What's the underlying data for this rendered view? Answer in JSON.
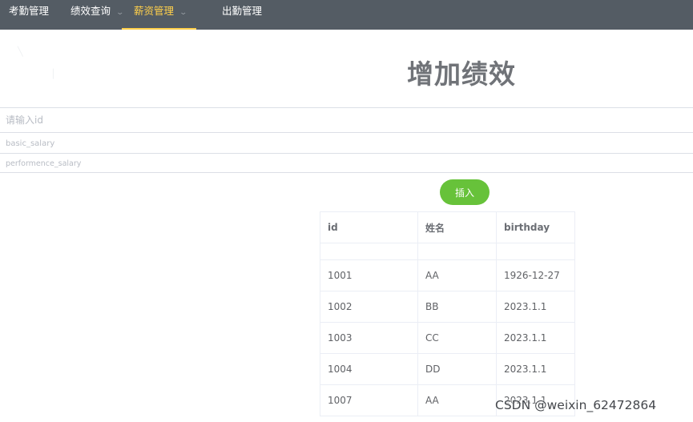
{
  "nav": {
    "items": [
      {
        "label": "考勤管理",
        "dropdown": false,
        "active": false
      },
      {
        "label": "绩效查询",
        "dropdown": true,
        "active": false
      },
      {
        "label": "薪资管理",
        "dropdown": true,
        "active": true
      },
      {
        "label": "出勤管理",
        "dropdown": false,
        "active": false
      }
    ]
  },
  "page": {
    "title": "增加绩效"
  },
  "form": {
    "id_placeholder": "请输入id",
    "basic_salary_placeholder": "basic_salary",
    "performance_salary_placeholder": "performence_salary",
    "insert_label": "插入"
  },
  "table": {
    "columns": [
      "id",
      "姓名",
      "birthday"
    ],
    "rows": [
      [
        "1001",
        "AA",
        "1926-12-27"
      ],
      [
        "1002",
        "BB",
        "2023.1.1"
      ],
      [
        "1003",
        "CC",
        "2023.1.1"
      ],
      [
        "1004",
        "DD",
        "2023.1.1"
      ],
      [
        "1007",
        "AA",
        "2023.1.1"
      ]
    ]
  },
  "watermark": "CSDN @weixin_62472864",
  "colors": {
    "nav_bg": "#545c64",
    "nav_active": "#ffd04b",
    "button_green": "#67c23a"
  }
}
